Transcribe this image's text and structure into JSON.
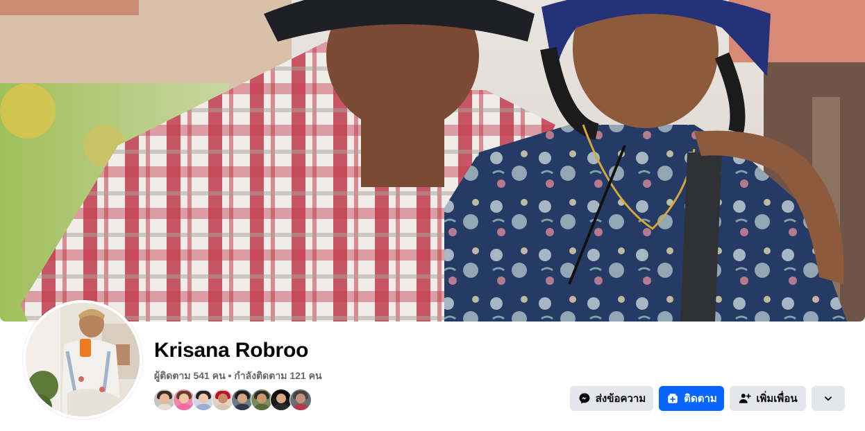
{
  "profile": {
    "name": "Krisana Robroo",
    "stats": "ผู้ติดตาม 541 คน • กำลังติดตาม 121 คน"
  },
  "friends_preview": [
    {
      "icon": "friend-avatar-1"
    },
    {
      "icon": "friend-avatar-2"
    },
    {
      "icon": "friend-avatar-3"
    },
    {
      "icon": "friend-avatar-4"
    },
    {
      "icon": "friend-avatar-5"
    },
    {
      "icon": "friend-avatar-6"
    },
    {
      "icon": "friend-avatar-7"
    },
    {
      "icon": "friend-avatar-8"
    }
  ],
  "actions": {
    "message_label": "ส่งข้อความ",
    "follow_label": "ติดตาม",
    "add_friend_label": "เพิ่มเพื่อน",
    "more_icon": "chevron-down-icon"
  },
  "icons": {
    "message": "messenger-icon",
    "follow": "follow-plus-icon",
    "add_friend": "add-friend-icon"
  },
  "colors": {
    "primary_button": "#0866ff",
    "secondary_button": "#e4e6eb",
    "name_text": "#050505",
    "meta_text": "#65676b"
  }
}
